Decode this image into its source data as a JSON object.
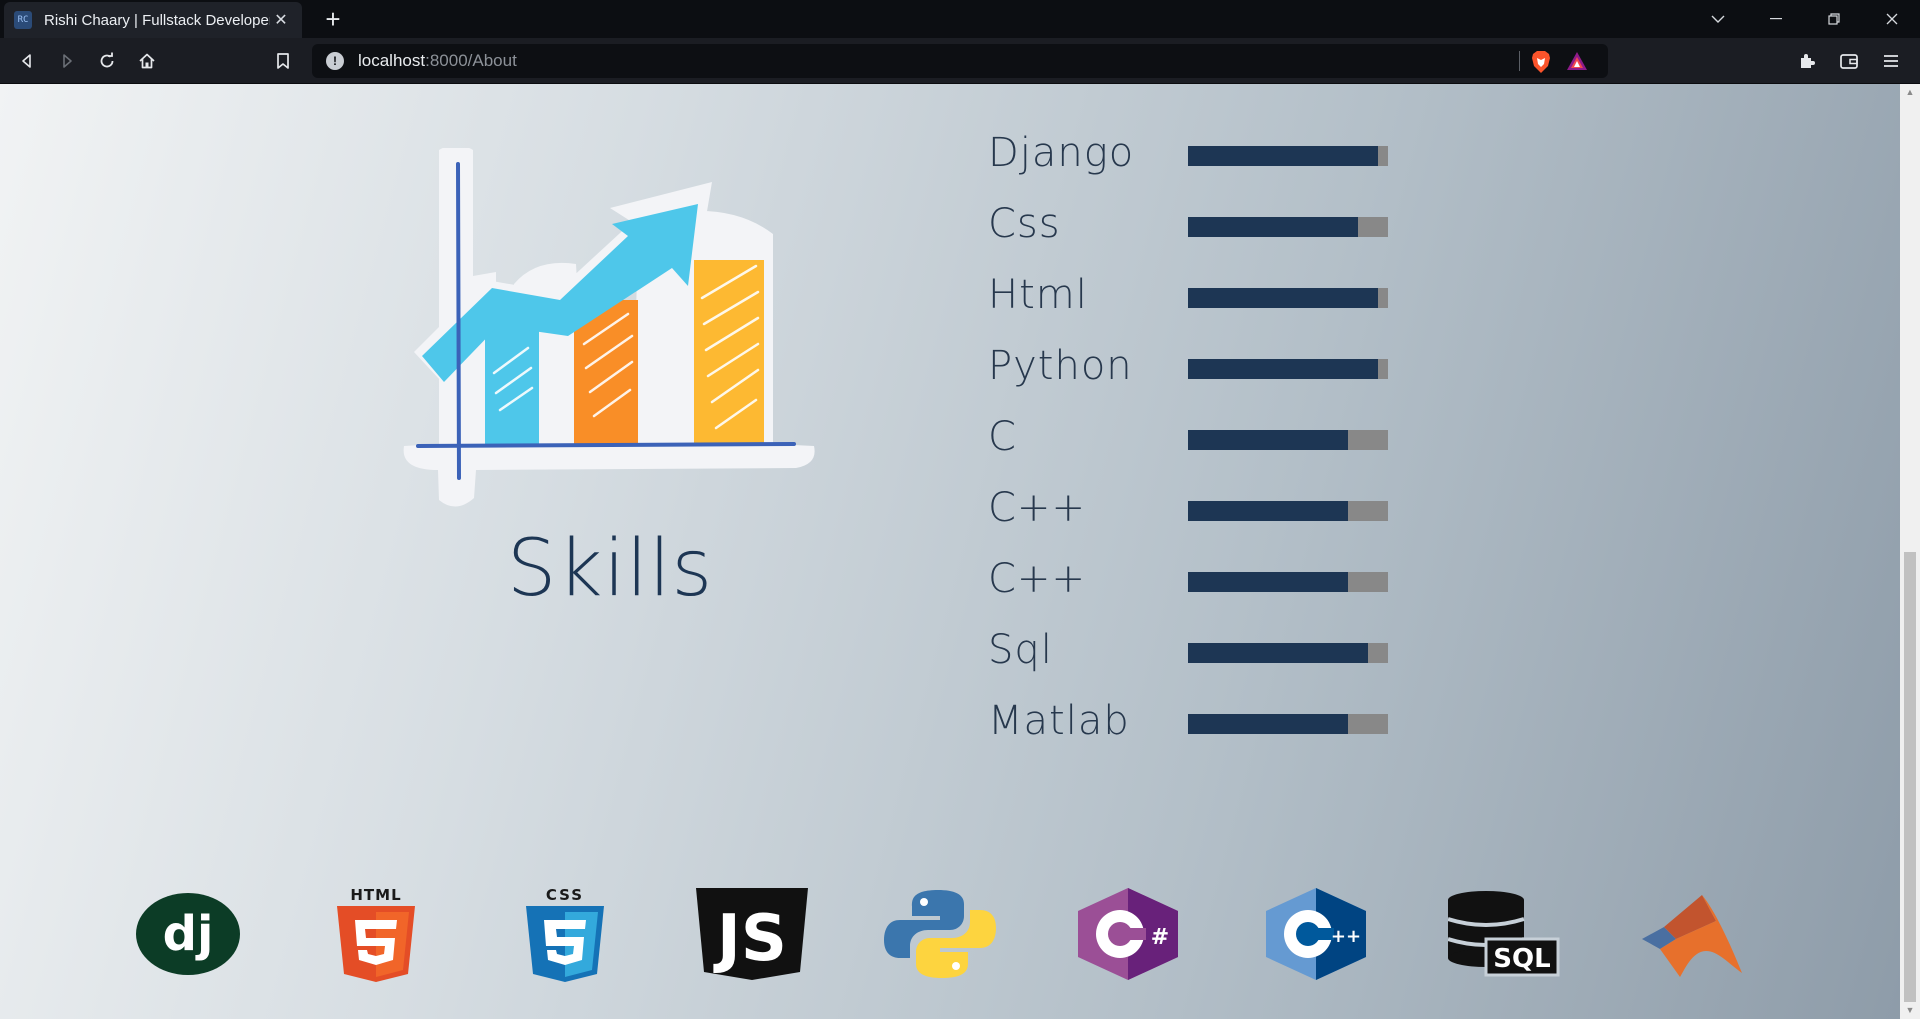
{
  "browser": {
    "tab_title": "Rishi Chaary | Fullstack Developer",
    "favicon_text": "RC",
    "url_host": "localhost",
    "url_path": ":8000/About"
  },
  "skills": {
    "title": "Skills",
    "items": [
      {
        "label": "Django",
        "level": 0.95
      },
      {
        "label": "Css",
        "level": 0.85
      },
      {
        "label": "Html",
        "level": 0.95
      },
      {
        "label": "Python",
        "level": 0.95
      },
      {
        "label": "C",
        "level": 0.8
      },
      {
        "label": "C++",
        "level": 0.8
      },
      {
        "label": "C++",
        "level": 0.8
      },
      {
        "label": "Sql",
        "level": 0.9
      },
      {
        "label": "Matlab",
        "level": 0.8
      }
    ],
    "bar_fill_color": "#1d3654",
    "bar_track_color": "#888888"
  },
  "tech_logos": [
    {
      "icon": "django-logo-icon",
      "text": "dj"
    },
    {
      "icon": "html5-logo-icon",
      "text": "HTML"
    },
    {
      "icon": "css3-logo-icon",
      "text": "CSS"
    },
    {
      "icon": "javascript-logo-icon",
      "text": "JS"
    },
    {
      "icon": "python-logo-icon"
    },
    {
      "icon": "csharp-logo-icon",
      "text": "#"
    },
    {
      "icon": "cplusplus-logo-icon",
      "text": "++"
    },
    {
      "icon": "sql-database-logo-icon",
      "text": "SQL"
    },
    {
      "icon": "matlab-logo-icon"
    }
  ]
}
